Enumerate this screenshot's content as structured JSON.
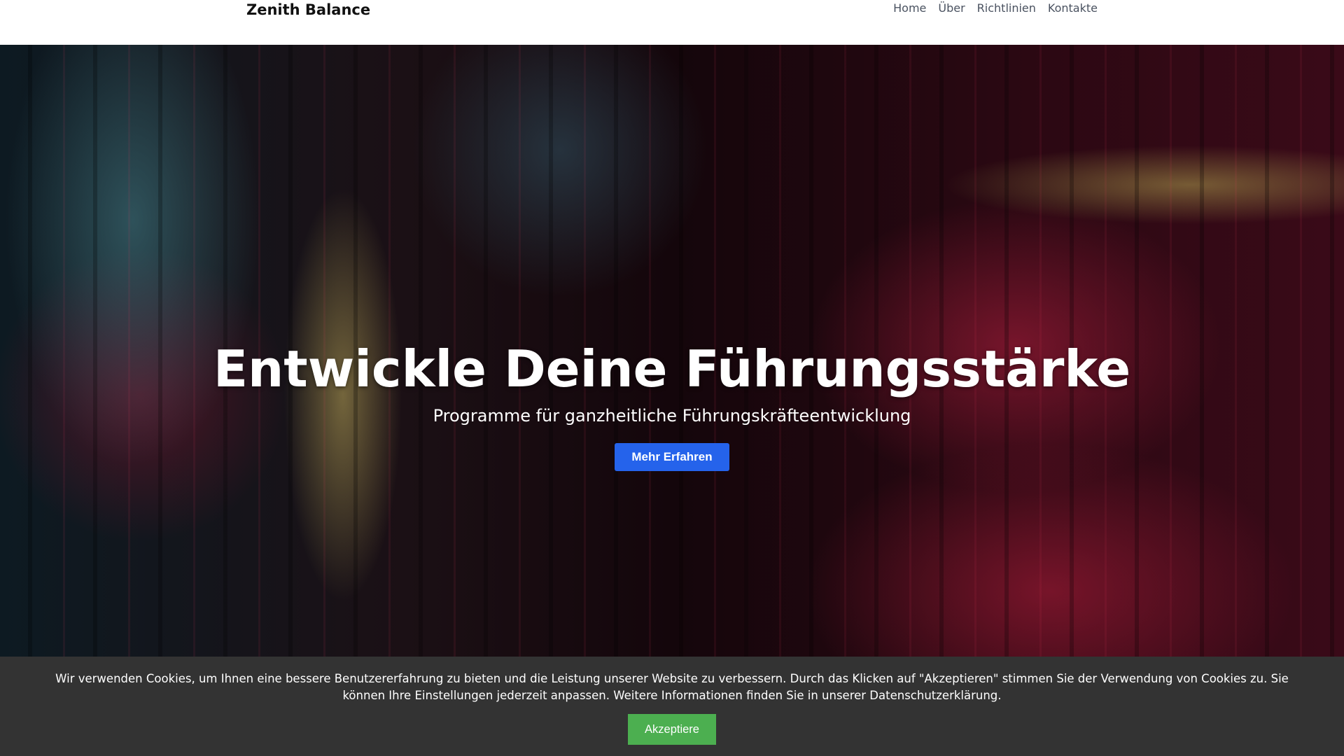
{
  "header": {
    "brand": "Zenith Balance",
    "nav": [
      "Home",
      "Über",
      "Richtlinien",
      "Kontakte"
    ]
  },
  "hero": {
    "title": "Entwickle Deine Führungsstärke",
    "subtitle": "Programme für ganzheitliche Führungskräfteentwicklung",
    "cta": "Mehr Erfahren"
  },
  "cookie": {
    "text": "Wir verwenden Cookies, um Ihnen eine bessere Benutzererfahrung zu bieten und die Leistung unserer Website zu verbessern. Durch das Klicken auf \"Akzeptieren\" stimmen Sie der Verwendung von Cookies zu. Sie können Ihre Einstellungen jederzeit anpassen. Weitere Informationen finden Sie in unserer Datenschutzerklärung.",
    "accept": "Akzeptiere"
  },
  "colors": {
    "cta": "#2563eb",
    "accept": "#4caf50",
    "cookie_bg": "#333333"
  }
}
